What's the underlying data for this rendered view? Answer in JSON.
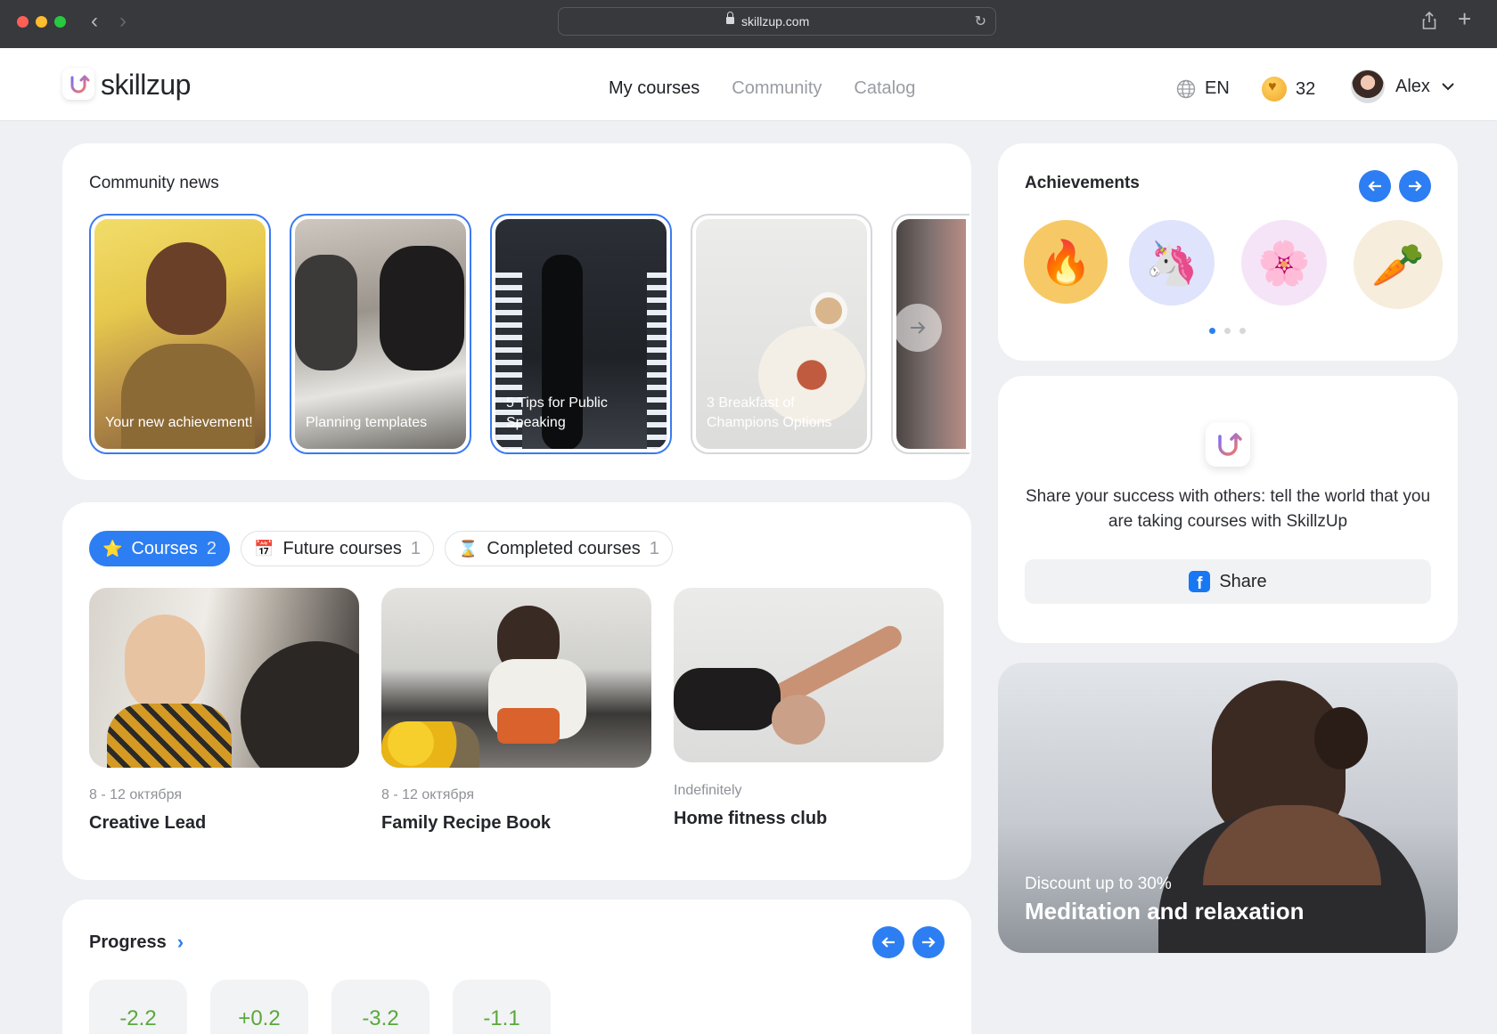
{
  "browser": {
    "url": "skillzup.com"
  },
  "header": {
    "logo_text": "skillzup",
    "nav": [
      {
        "label": "My courses",
        "active": true
      },
      {
        "label": "Community",
        "active": false
      },
      {
        "label": "Catalog",
        "active": false
      }
    ],
    "language": "EN",
    "coins": "32",
    "user_name": "Alex"
  },
  "community_news": {
    "title": "Community news",
    "stories": [
      {
        "caption": "Your new achievement!",
        "seen": false
      },
      {
        "caption": "Planning templates",
        "seen": false
      },
      {
        "caption": "5 Tips for Public Speaking",
        "seen": false
      },
      {
        "caption": "3 Breakfast of Champions Options",
        "seen": true
      },
      {
        "caption": "",
        "seen": true
      }
    ]
  },
  "courses": {
    "tabs": [
      {
        "label": "Courses",
        "count": "2",
        "icon": "star-icon",
        "active": true
      },
      {
        "label": "Future courses",
        "count": "1",
        "icon": "calendar-icon",
        "active": false
      },
      {
        "label": "Completed courses",
        "count": "1",
        "icon": "hourglass-icon",
        "active": false
      }
    ],
    "items": [
      {
        "date": "8 - 12 октября",
        "title": "Creative Lead"
      },
      {
        "date": "8 - 12 октября",
        "title": "Family Recipe Book"
      },
      {
        "date": "Indefinitely",
        "title": "Home fitness club"
      }
    ]
  },
  "progress": {
    "title": "Progress",
    "stats": [
      "-2.2",
      "+0.2",
      "-3.2",
      "-1.1"
    ]
  },
  "achievements": {
    "title": "Achievements",
    "badges": [
      "fire-icon",
      "unicorn-icon",
      "flower-icon",
      "carrot-icon"
    ],
    "page": 1,
    "pages": 3
  },
  "share": {
    "text": "Share your success with others: tell the world that you are taking courses with SkillzUp",
    "button_label": "Share"
  },
  "promo": {
    "subtitle": "Discount up to 30%",
    "title": "Meditation and relaxation"
  },
  "colors": {
    "accent": "#2c7ef2",
    "positive": "#5ba83a"
  }
}
